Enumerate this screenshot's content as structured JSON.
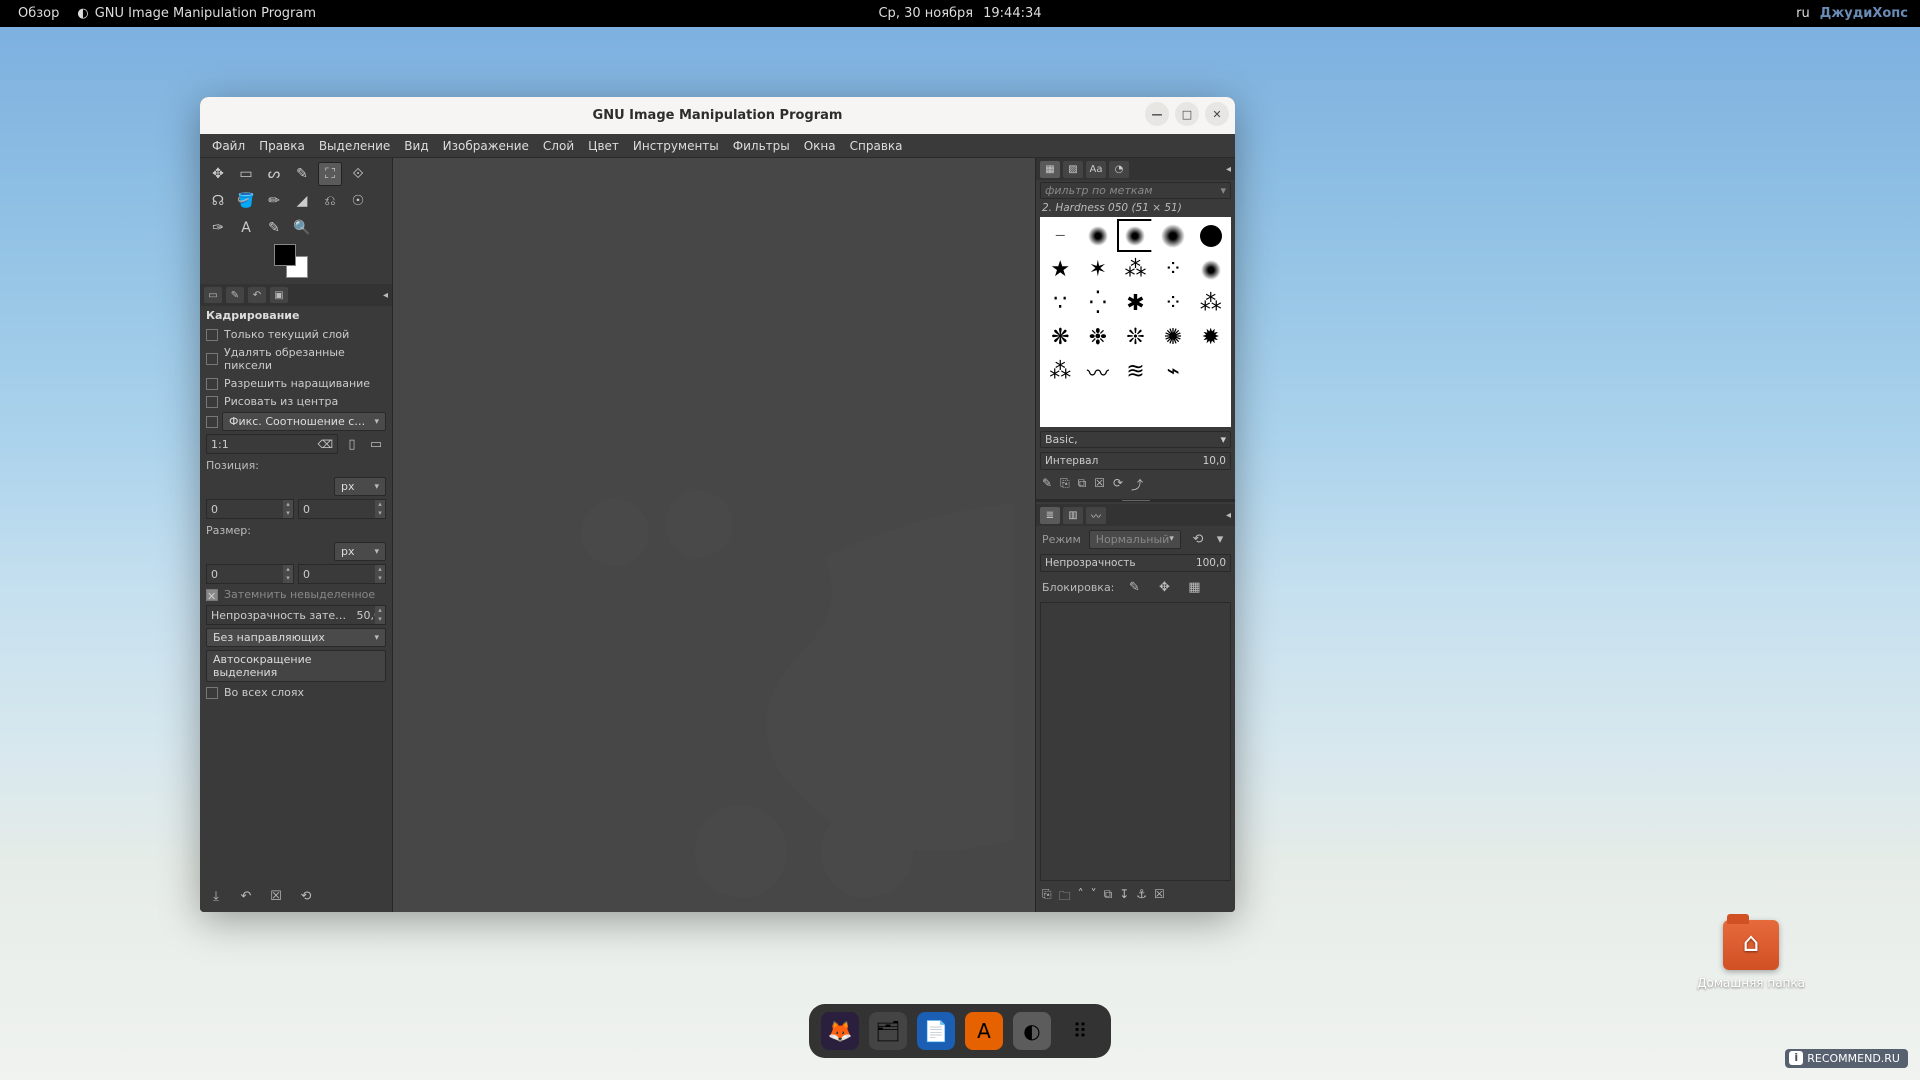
{
  "topbar": {
    "overview": "Обзор",
    "app": "GNU Image Manipulation Program",
    "date": "Ср, 30 ноября",
    "time": "19:44:34",
    "lang": "ru",
    "watermark": "ДжудиХопс"
  },
  "desktop": {
    "home_folder": "Домашняя папка"
  },
  "dock": {
    "items": [
      "firefox",
      "files",
      "document",
      "software",
      "gimp",
      "apps"
    ]
  },
  "window": {
    "title": "GNU Image Manipulation Program",
    "min": "—",
    "max": "□",
    "close": "✕"
  },
  "menu": {
    "file": "Файл",
    "edit": "Правка",
    "select": "Выделение",
    "view": "Вид",
    "image": "Изображение",
    "layer": "Слой",
    "color": "Цвет",
    "tools": "Инструменты",
    "filters": "Фильтры",
    "windows": "Окна",
    "help": "Справка"
  },
  "tooloptions": {
    "title": "Кадрирование",
    "only_current": "Только текущий слой",
    "delete_cropped": "Удалять обрезанные пиксели",
    "allow_grow": "Разрешить наращивание",
    "from_center": "Рисовать из центра",
    "fixed": "Фикс.",
    "fixed_value": "Соотношение с…",
    "ratio": "1:1",
    "position": "Позиция:",
    "pos_x": "0",
    "pos_y": "0",
    "unit_px": "px",
    "size": "Размер:",
    "size_w": "0",
    "size_h": "0",
    "darken": "Затемнить невыделенное",
    "darken_opacity_label": "Непрозрачность зате…",
    "darken_opacity": "50,0",
    "guides": "Без направляющих",
    "autoshrink": "Автосокращение выделения",
    "all_layers": "Во всех слоях"
  },
  "brushes": {
    "filter_placeholder": "фильтр по меткам",
    "current": "2. Hardness 050 (51 × 51)",
    "preset_group": "Basic,",
    "interval_label": "Интервал",
    "interval_value": "10,0"
  },
  "layers": {
    "mode_label": "Режим",
    "mode_value": "Нормальный",
    "opacity_label": "Непрозрачность",
    "opacity_value": "100,0",
    "lock_label": "Блокировка:"
  },
  "watermark_site": "RECOMMEND.RU"
}
